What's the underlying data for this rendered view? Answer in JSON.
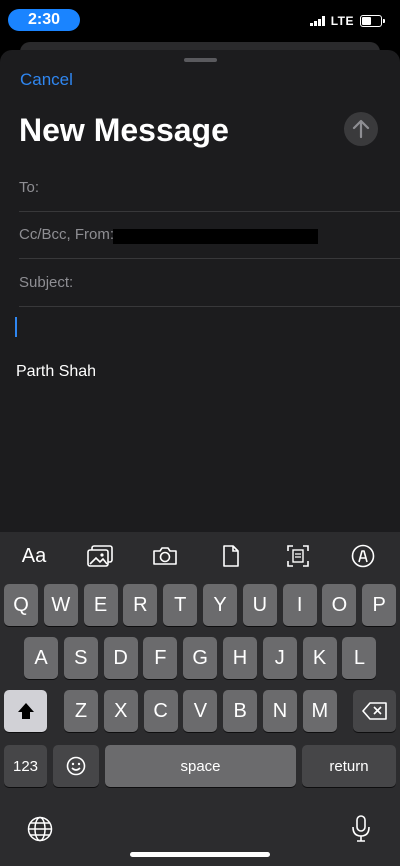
{
  "status_bar": {
    "time": "2:30",
    "network": "LTE",
    "battery_level": 0.45
  },
  "compose": {
    "cancel_label": "Cancel",
    "title": "New Message",
    "fields": {
      "to_label": "To:",
      "cc_from_label": "Cc/Bcc, From:",
      "subject_label": "Subject:"
    },
    "signature": "Parth Shah"
  },
  "format_bar": {
    "text_format_label": "Aa",
    "icons": [
      "photo-library-icon",
      "camera-icon",
      "document-icon",
      "scan-document-icon",
      "markup-icon"
    ]
  },
  "keyboard": {
    "row1": [
      "Q",
      "W",
      "E",
      "R",
      "T",
      "Y",
      "U",
      "I",
      "O",
      "P"
    ],
    "row2": [
      "A",
      "S",
      "D",
      "F",
      "G",
      "H",
      "J",
      "K",
      "L"
    ],
    "row3": [
      "Z",
      "X",
      "C",
      "V",
      "B",
      "N",
      "M"
    ],
    "numbers_label": "123",
    "space_label": "space",
    "return_label": "return"
  },
  "colors": {
    "accent": "#2f86f0",
    "time_pill": "#1a84ff"
  }
}
